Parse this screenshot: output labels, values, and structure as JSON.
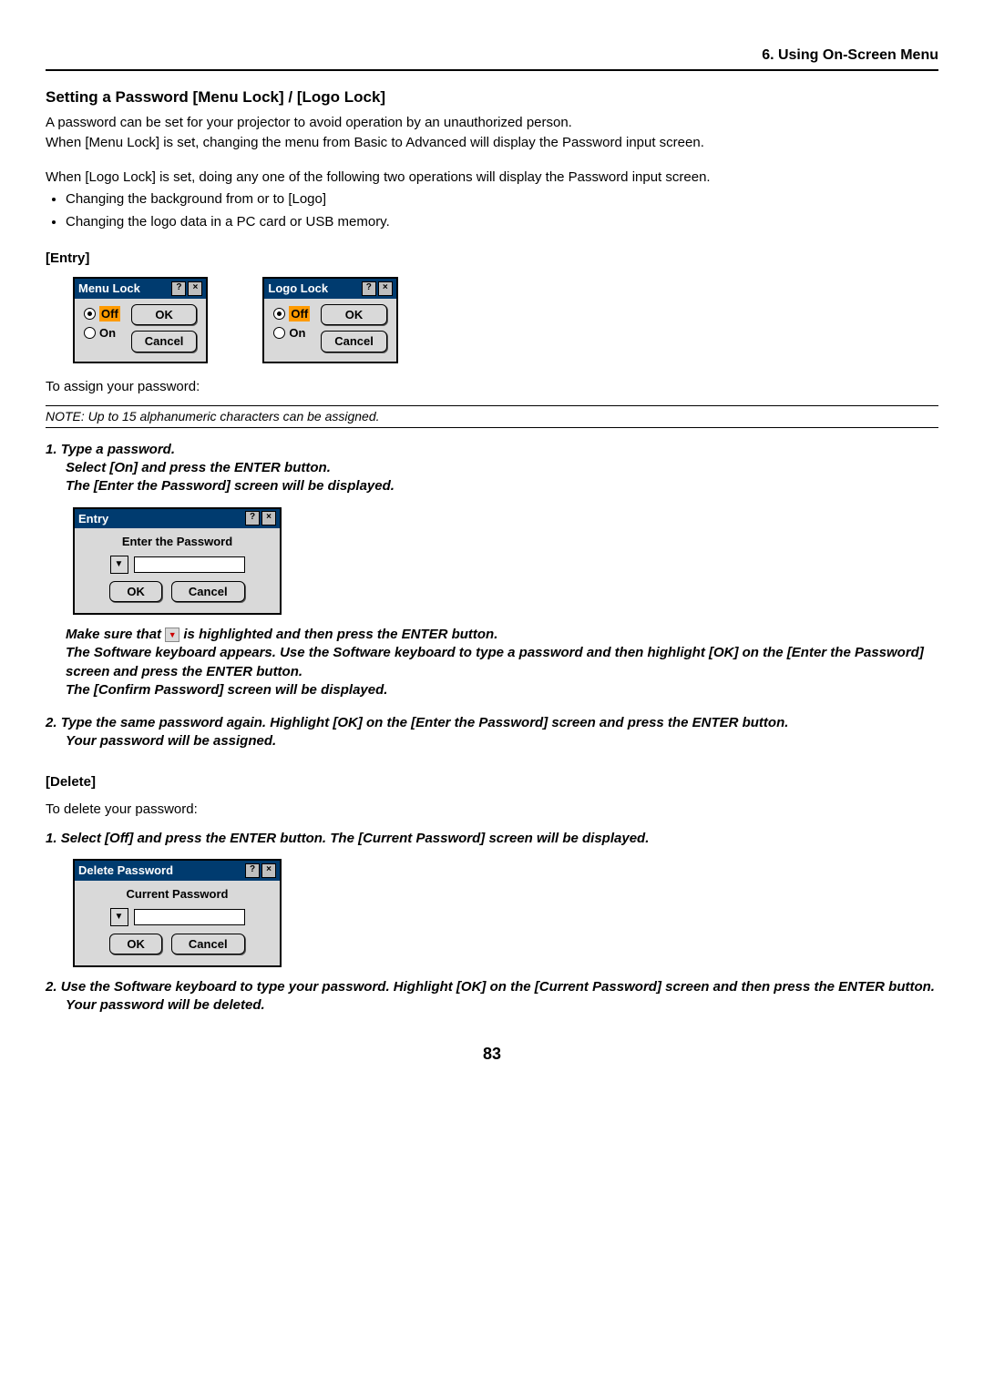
{
  "header": {
    "section": "6. Using On-Screen Menu"
  },
  "title": "Setting a Password [Menu Lock] / [Logo Lock]",
  "intro": {
    "p1": "A password can be set for your projector to avoid operation by an unauthorized person.",
    "p2": "When [Menu Lock] is set, changing the menu from Basic to Advanced will display the Password input screen.",
    "p3": "When [Logo Lock] is set, doing any one of the following two operations will display the Password input screen."
  },
  "bullets": {
    "b1": "Changing the background from or to [Logo]",
    "b2": "Changing the logo data in a PC card or USB memory."
  },
  "entry": {
    "heading": "[Entry]",
    "menuLock": {
      "title": "Menu Lock",
      "off": "Off",
      "on": "On",
      "ok": "OK",
      "cancel": "Cancel"
    },
    "logoLock": {
      "title": "Logo Lock",
      "off": "Off",
      "on": "On",
      "ok": "OK",
      "cancel": "Cancel"
    },
    "assign": "To assign your password:"
  },
  "note": "NOTE: Up to 15 alphanumeric characters can be assigned.",
  "steps": {
    "s1_num": "1.",
    "s1_a": "Type a password.",
    "s1_b": "Select [On] and press the ENTER button.",
    "s1_c": "The [Enter the Password] screen will be displayed.",
    "entryDlg": {
      "title": "Entry",
      "label": "Enter the Password",
      "ok": "OK",
      "cancel": "Cancel"
    },
    "s1_d_pre": "Make sure that ",
    "s1_d_post": " is highlighted and then press the ENTER button.",
    "s1_e": "The Software keyboard appears. Use the Software keyboard to type a password and then highlight [OK] on the [Enter the Password] screen and press the ENTER button.",
    "s1_f": "The [Confirm Password] screen will be displayed.",
    "s2_num": "2.",
    "s2_a": "Type the same password again. Highlight [OK] on the [Enter the Password] screen and press the ENTER button.",
    "s2_b": "Your password will be assigned."
  },
  "delete": {
    "heading": "[Delete]",
    "lead": "To delete your password:",
    "d1_num": "1.",
    "d1": "Select [Off] and press the ENTER button. The [Current Password] screen will be displayed.",
    "dlg": {
      "title": "Delete Password",
      "label": "Current Password",
      "ok": "OK",
      "cancel": "Cancel"
    },
    "d2_num": "2.",
    "d2a": "Use the Software keyboard to type your password. Highlight [OK] on the [Current Password] screen and then press the ENTER button.",
    "d2b": "Your password will be deleted."
  },
  "page": "83"
}
